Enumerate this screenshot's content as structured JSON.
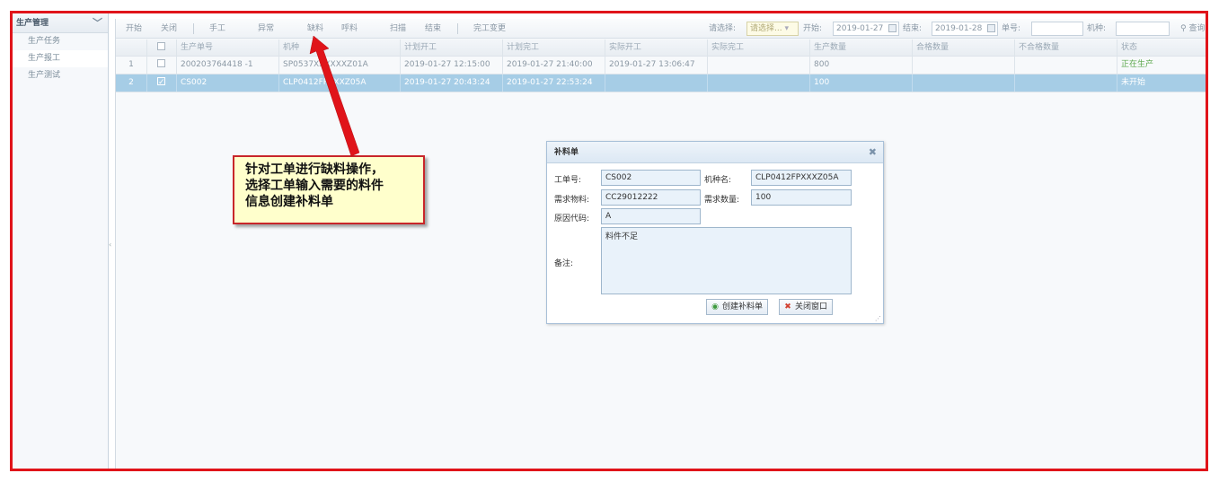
{
  "sidebar": {
    "title": "生产管理",
    "items": [
      "生产任务",
      "生产报工",
      "生产测试"
    ]
  },
  "toolbar": {
    "buttons": [
      "开始",
      "关闭",
      "手工",
      "异常",
      "缺料",
      "呼料",
      "扫描",
      "结束",
      "完工变更"
    ],
    "select_label": "请选择:",
    "select_placeholder": "请选择...",
    "start_label": "开始:",
    "start_value": "2019-01-27",
    "end_label": "结束:",
    "end_value": "2019-01-28",
    "order_label": "单号:",
    "model_label": "机种:",
    "search_label": "查询"
  },
  "grid": {
    "columns": [
      "生产单号",
      "机种",
      "计划开工",
      "计划完工",
      "实际开工",
      "实际完工",
      "生产数量",
      "合格数量",
      "不合格数量",
      "状态"
    ],
    "rows": [
      {
        "num": "1",
        "checked": false,
        "cells": [
          "200203764418 -1",
          "SP0537XXXXXXZ01A",
          "2019-01-27 12:15:00",
          "2019-01-27 21:40:00",
          "2019-01-27 13:06:47",
          "",
          "800",
          "",
          "",
          "正在生产"
        ]
      },
      {
        "num": "2",
        "checked": true,
        "cells": [
          "CS002",
          "CLP0412FPXXXZ05A",
          "2019-01-27 20:43:24",
          "2019-01-27 22:53:24",
          "",
          "",
          "100",
          "",
          "",
          "未开始"
        ]
      }
    ]
  },
  "dialog": {
    "title": "补料单",
    "order_label": "工单号:",
    "order_value": "CS002",
    "model_label": "机种名:",
    "model_value": "CLP0412FPXXXZ05A",
    "material_label": "需求物料:",
    "material_value": "CC29012222",
    "qty_label": "需求数量:",
    "qty_value": "100",
    "reason_label": "原因代码:",
    "reason_value": "A",
    "remark_label": "备注:",
    "remark_value": "料件不足",
    "create_button": "创建补料单",
    "close_button": "关闭窗口"
  },
  "annotation": {
    "lines": [
      "针对工单进行缺料操作，",
      "选择工单输入需要的料件",
      "信息创建补料单"
    ]
  },
  "colors": {
    "frame": "#e0141a",
    "selected_row": "#a6cde6",
    "status_green": "#5aa74a",
    "callout_bg": "#ffffcc"
  }
}
